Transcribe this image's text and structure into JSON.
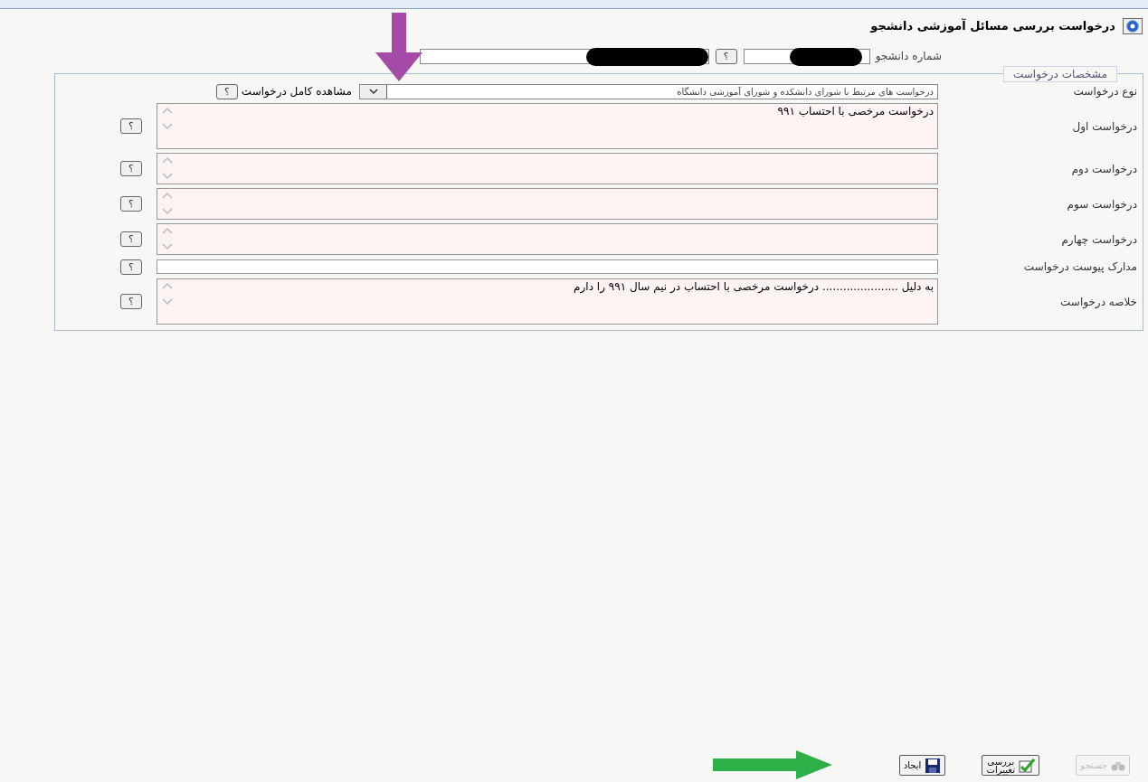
{
  "header": {
    "title": "درخواست بررسی مسائل آموزشی دانشجو"
  },
  "student": {
    "label": "شماره دانشجو",
    "number_redacted": true,
    "help": "؟",
    "name_redacted": true
  },
  "section": {
    "legend": "مشخصات درخواست"
  },
  "rows": [
    {
      "kind": "select",
      "label": "نوع درخواست",
      "value": "درخواست های مرتبط با شورای دانشکده و شورای آموزشی دانشگاه",
      "link": "مشاهده کامل درخواست",
      "help": "؟"
    },
    {
      "kind": "textarea",
      "label": "درخواست اول",
      "value": "درخواست مرخصی با احتساب ۹۹۱",
      "tall": true,
      "help": "؟"
    },
    {
      "kind": "textarea",
      "label": "درخواست دوم",
      "tall": false,
      "help": "؟"
    },
    {
      "kind": "textarea",
      "label": "درخواست سوم",
      "tall": false,
      "help": "؟"
    },
    {
      "kind": "textarea",
      "label": "درخواست چهارم",
      "tall": false,
      "help": "؟"
    },
    {
      "kind": "input",
      "label": "مدارک پیوست درخواست",
      "help": "؟"
    },
    {
      "kind": "textarea",
      "label": "خلاصه درخواست",
      "value": "به دلیل ...................... درخواست مرخصی با احتساب در نیم سال ۹۹۱ را دارم",
      "tall": true,
      "help": "؟"
    }
  ],
  "buttons": [
    {
      "kind": "search",
      "label": "جستجو",
      "disabled": true
    },
    {
      "kind": "review",
      "label": "بررسی تغییرات",
      "disabled": false
    },
    {
      "kind": "create",
      "label": "ایجاد",
      "disabled": false
    }
  ]
}
